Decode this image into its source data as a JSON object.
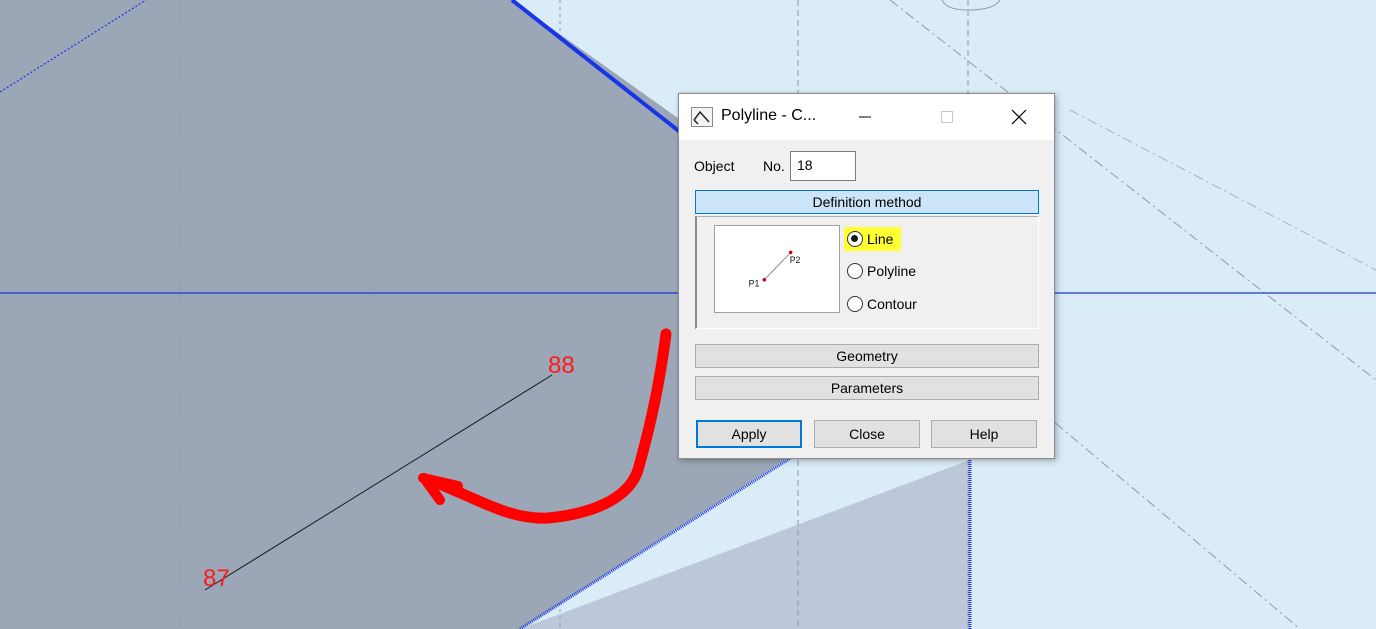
{
  "canvas": {
    "node_labels": [
      "88",
      "87"
    ],
    "colors": {
      "background": "#d9ecf7",
      "panel_dark": "#9ba7b6",
      "panel_light": "#bcc8d9",
      "highlight_edge": "#1a35e6",
      "axis_line": "#1f35d6",
      "annotation": "#ff0000"
    }
  },
  "dialog": {
    "title": "Polyline - C...",
    "title_icon": "polyline-tool-icon",
    "controls": {
      "minimize": "minimize-icon",
      "maximize": "maximize-icon",
      "close": "close-icon"
    },
    "object_label": "Object",
    "no_label": "No.",
    "object_number": "18",
    "sections": {
      "definition_method": "Definition method",
      "geometry": "Geometry",
      "parameters": "Parameters"
    },
    "preview": {
      "p1_label": "P1",
      "p2_label": "P2"
    },
    "methods": [
      {
        "label": "Line",
        "selected": true
      },
      {
        "label": "Polyline",
        "selected": false
      },
      {
        "label": "Contour",
        "selected": false
      }
    ],
    "buttons": {
      "apply": "Apply",
      "close": "Close",
      "help": "Help"
    }
  }
}
